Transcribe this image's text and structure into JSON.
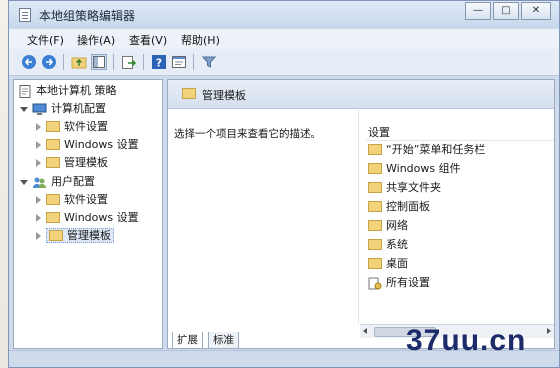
{
  "window": {
    "title": "本地组策略编辑器"
  },
  "menubar": [
    "文件(F)",
    "操作(A)",
    "查看(V)",
    "帮助(H)"
  ],
  "toolbar": [
    "back-icon",
    "forward-icon",
    "up-folder-icon",
    "show-tree-icon",
    "export-icon",
    "help-icon",
    "properties-icon",
    "filter-icon"
  ],
  "tree": [
    {
      "label": "本地计算机 策略",
      "level": 0,
      "expander": "none",
      "icon": "policy-icon"
    },
    {
      "label": "计算机配置",
      "level": 1,
      "expander": "open",
      "icon": "computer-icon"
    },
    {
      "label": "软件设置",
      "level": 2,
      "expander": "closed",
      "icon": "folder-icon"
    },
    {
      "label": "Windows 设置",
      "level": 2,
      "expander": "closed",
      "icon": "folder-icon"
    },
    {
      "label": "管理模板",
      "level": 2,
      "expander": "closed",
      "icon": "folder-icon"
    },
    {
      "label": "用户配置",
      "level": 1,
      "expander": "open",
      "icon": "users-icon"
    },
    {
      "label": "软件设置",
      "level": 2,
      "expander": "closed",
      "icon": "folder-icon"
    },
    {
      "label": "Windows 设置",
      "level": 2,
      "expander": "closed",
      "icon": "folder-icon"
    },
    {
      "label": "管理模板",
      "level": 2,
      "expander": "closed",
      "icon": "folder-icon",
      "selected": true
    }
  ],
  "right": {
    "header": "管理模板",
    "description": "选择一个项目来查看它的描述。",
    "list_header": "设置",
    "items": [
      "“开始”菜单和任务栏",
      "Windows 组件",
      "共享文件夹",
      "控制面板",
      "网络",
      "系统",
      "桌面",
      "所有设置"
    ]
  },
  "tabs": [
    "扩展",
    "标准"
  ],
  "watermark": "37uu.cn"
}
